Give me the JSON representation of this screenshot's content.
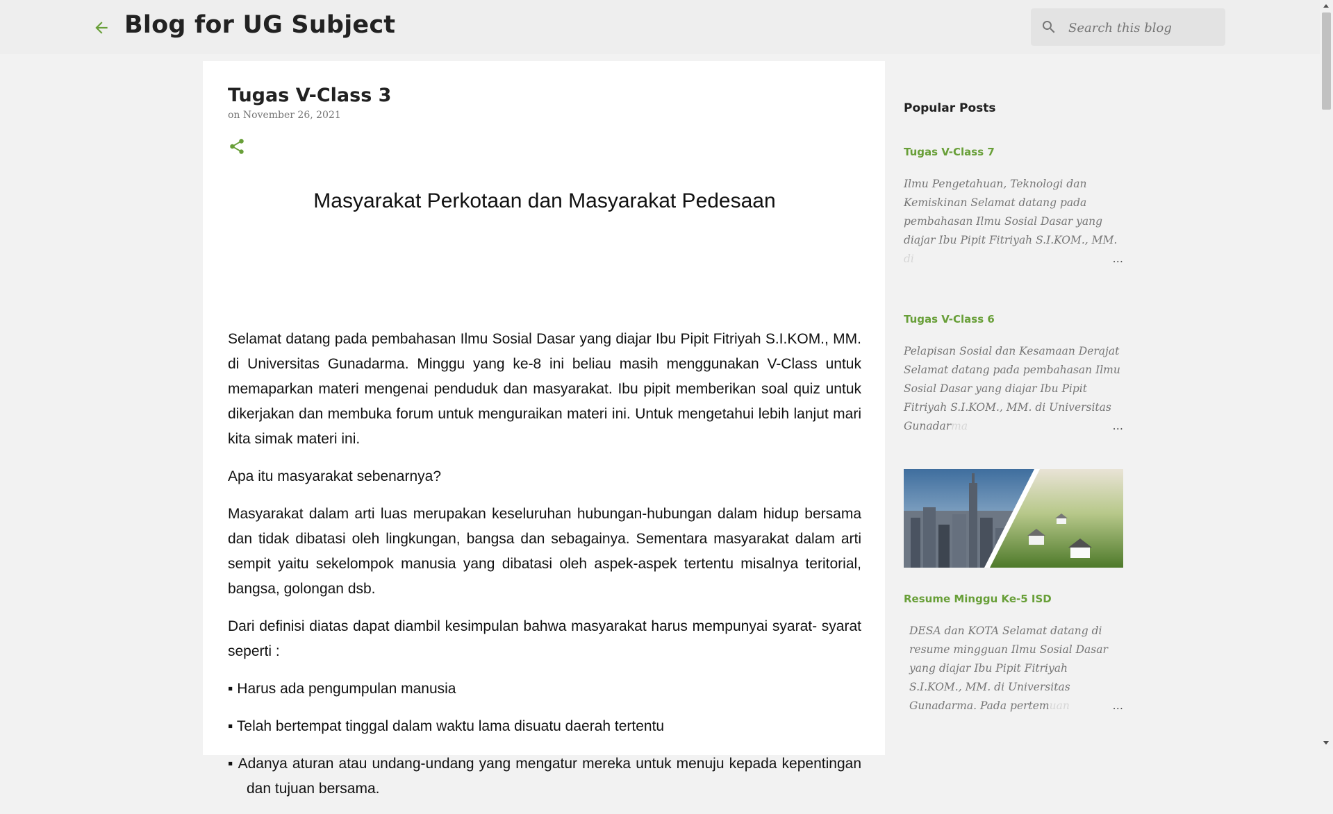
{
  "header": {
    "blog_title": "Blog for UG Subject",
    "search_placeholder": "Search this blog"
  },
  "post": {
    "title": "Tugas V-Class 3",
    "date": "on November 26, 2021",
    "heading": "Masyarakat Perkotaan dan Masyarakat Pedesaan",
    "paragraphs": [
      "Selamat datang pada pembahasan Ilmu Sosial Dasar yang diajar Ibu Pipit Fitriyah S.I.KOM., MM. di Universitas Gunadarma. Minggu yang ke-8 ini beliau masih menggunakan V-Class untuk memaparkan materi mengenai penduduk dan masyarakat. Ibu pipit memberikan soal quiz untuk dikerjakan dan membuka forum untuk menguraikan materi ini. Untuk mengetahui lebih lanjut mari kita simak materi ini.",
      "Apa itu masyarakat sebenarnya?",
      "Masyarakat dalam arti luas merupakan keseluruhan hubungan-hubungan dalam hidup bersama dan tidak dibatasi oleh lingkungan, bangsa dan sebagainya. Sementara masyarakat dalam arti sempit yaitu sekelompok manusia yang dibatasi oleh aspek-aspek tertentu misalnya teritorial, bangsa, golongan dsb.",
      "Dari definisi diatas dapat diambil kesimpulan bahwa masyarakat harus mempunyai syarat- syarat seperti :"
    ],
    "bullets": [
      "▪ Harus ada pengumpulan manusia",
      "▪ Telah bertempat tinggal dalam waktu lama disuatu daerah tertentu",
      "▪ Adanya aturan atau undang-undang yang mengatur mereka untuk menuju kepada kepentingan dan tujuan bersama."
    ]
  },
  "sidebar": {
    "heading": "Popular Posts",
    "posts": [
      {
        "title": "Tugas V-Class 7",
        "snippet": "Ilmu Pengetahuan, Teknologi dan Kemiskinan Selamat datang pada pembahasan Ilmu Sosial Dasar yang diajar Ibu Pipit Fitriyah S.I.KOM., MM.",
        "snippet_fade": " di"
      },
      {
        "title": "Tugas V-Class 6",
        "snippet": "Pelapisan Sosial dan Kesamaan Derajat Selamat datang pada pembahasan Ilmu Sosial Dasar yang diajar Ibu Pipit Fitriyah S.I.KOM., MM. di Universitas Gunadar",
        "snippet_fade": "ma"
      },
      {
        "title": "Resume Minggu Ke-5 ISD",
        "snippet": "DESA dan KOTA Selamat datang di resume mingguan Ilmu Sosial Dasar yang diajar Ibu Pipit Fitriyah S.I.KOM., MM. di Universitas Gunadarma. Pada pertem",
        "snippet_fade": "uan"
      }
    ],
    "ellipsis": "…"
  },
  "colors": {
    "accent": "#689f38",
    "header_bg": "#eeeeee",
    "page_bg": "#f2f2f2"
  },
  "icons": [
    "back-arrow-icon",
    "search-icon",
    "share-icon"
  ]
}
